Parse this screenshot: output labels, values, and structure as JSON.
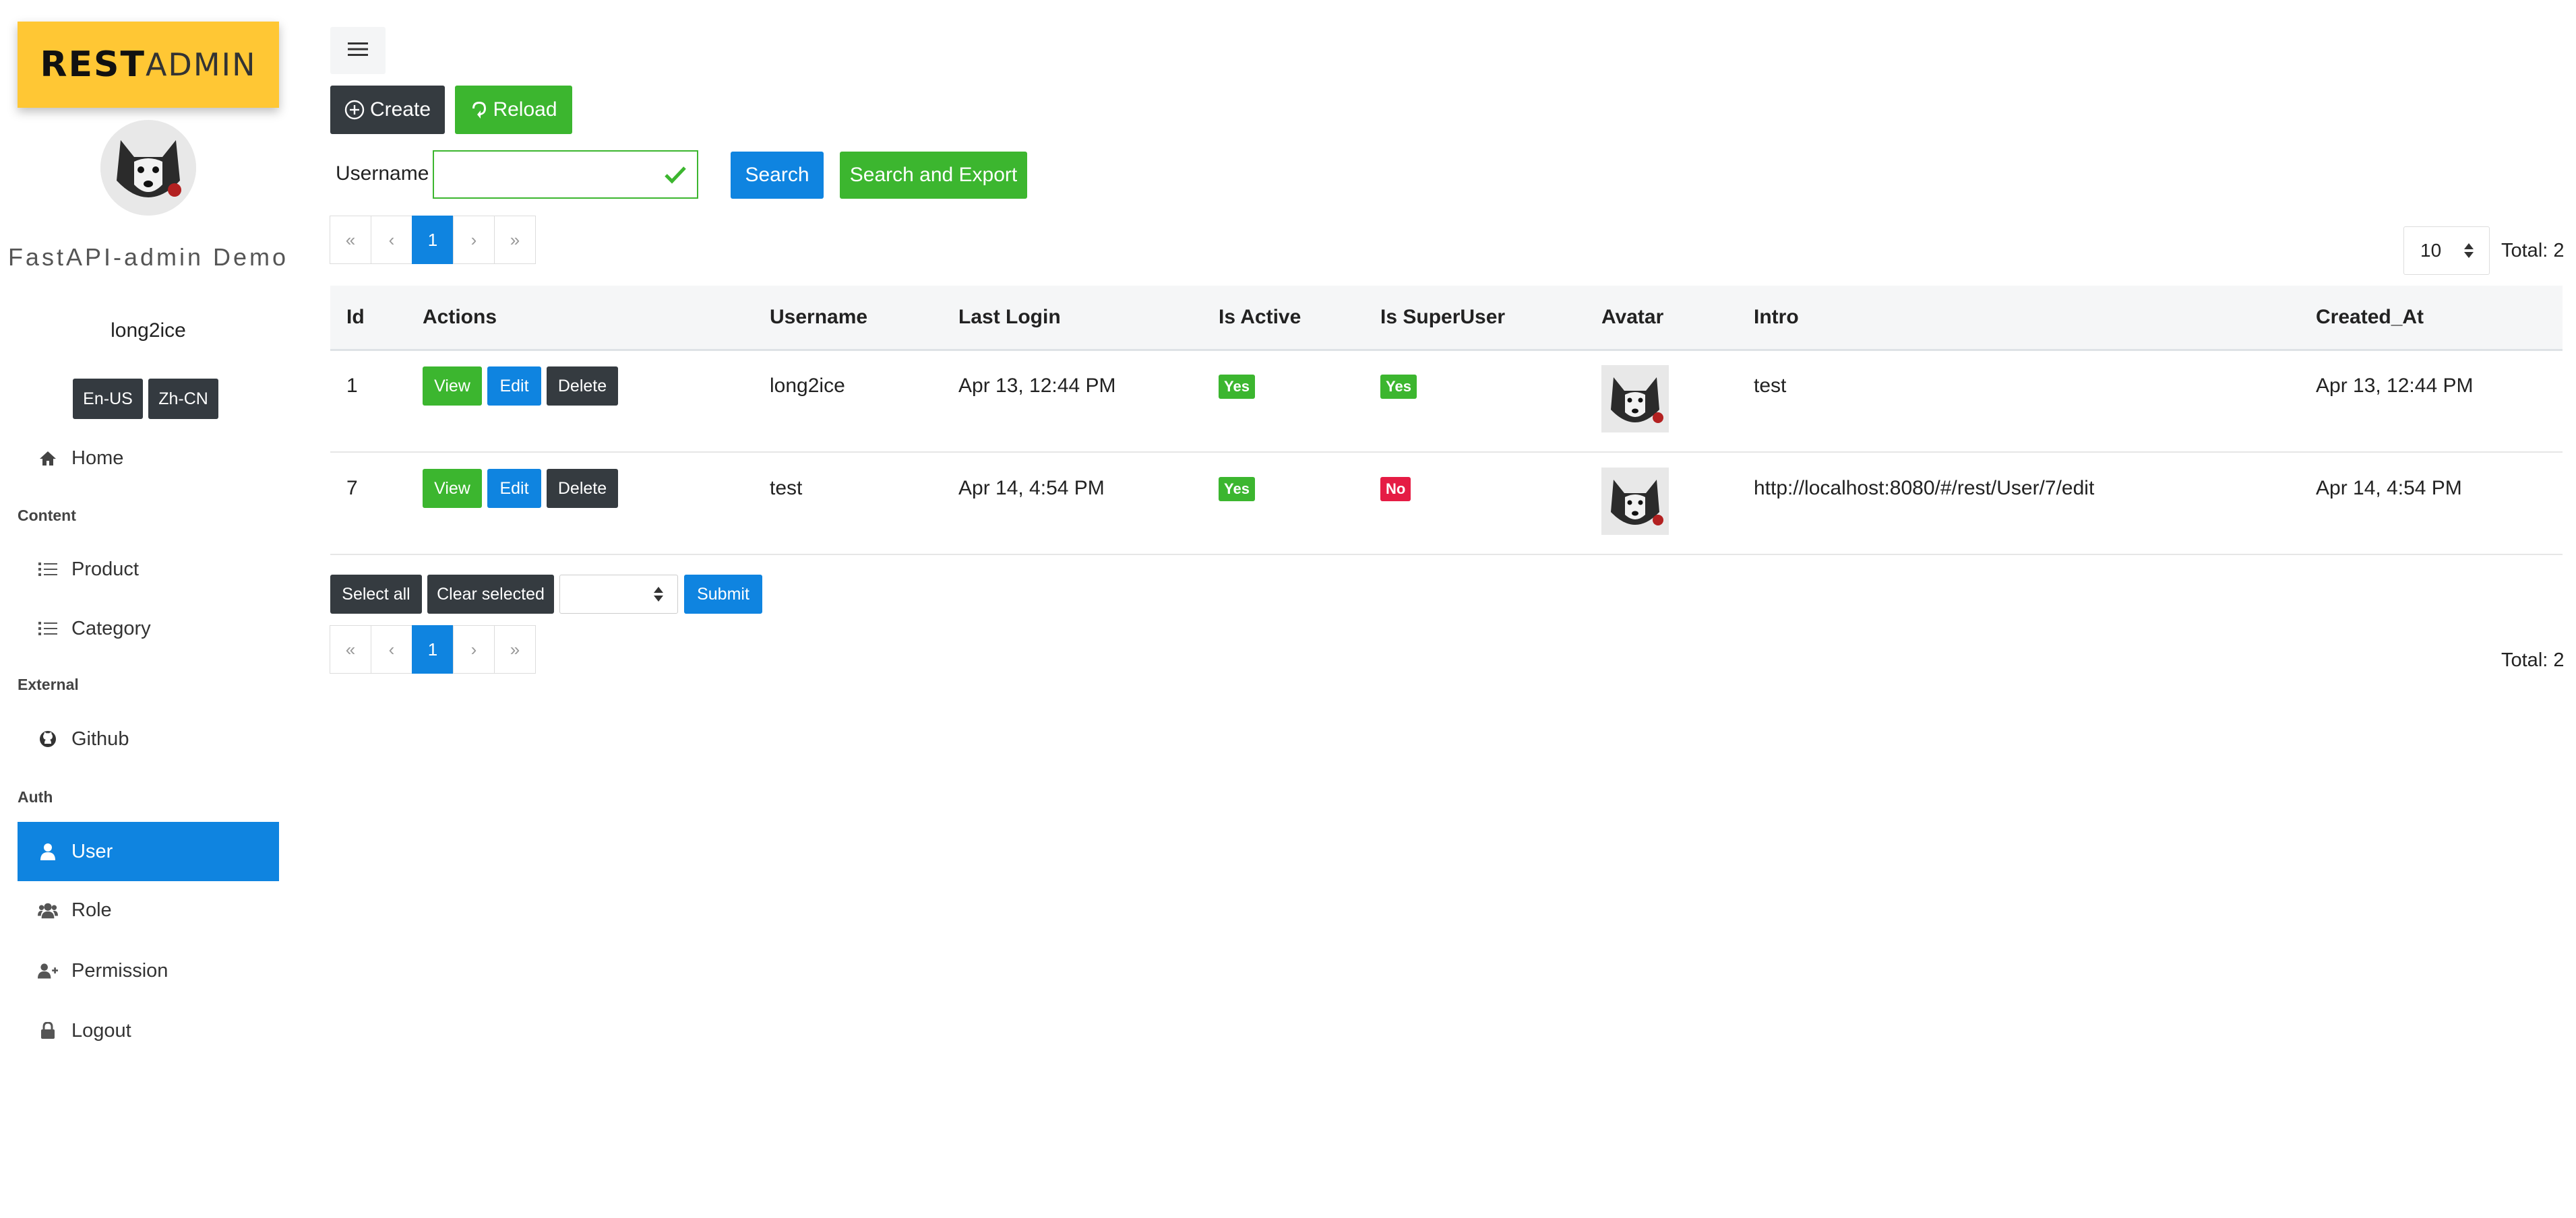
{
  "brand": {
    "logo_rest": "REST",
    "logo_admin": "ADMIN"
  },
  "sidebar": {
    "site_name": "FastAPI-admin Demo",
    "user_name": "long2ice",
    "lang_buttons": [
      "En-US",
      "Zh-CN"
    ],
    "home": "Home",
    "sections": {
      "content": "Content",
      "external": "External",
      "auth": "Auth"
    },
    "items": {
      "product": "Product",
      "category": "Category",
      "github": "Github",
      "user": "User",
      "role": "Role",
      "permission": "Permission",
      "logout": "Logout"
    },
    "active_item": "User"
  },
  "toolbar": {
    "create_label": "Create",
    "reload_label": "Reload"
  },
  "filter": {
    "username_label": "Username",
    "username_value": "",
    "search_label": "Search",
    "search_export_label": "Search and Export"
  },
  "pagination": {
    "first": "«",
    "prev": "‹",
    "current": "1",
    "next": "›",
    "last": "»",
    "per_page": "10",
    "total_label": "Total: 2"
  },
  "table": {
    "columns": [
      "Id",
      "Actions",
      "Username",
      "Last Login",
      "Is Active",
      "Is SuperUser",
      "Avatar",
      "Intro",
      "Created_At"
    ],
    "action_labels": {
      "view": "View",
      "edit": "Edit",
      "delete": "Delete"
    },
    "rows": [
      {
        "id": "1",
        "username": "long2ice",
        "last_login": "Apr 13, 12:44 PM",
        "is_active": "Yes",
        "is_superuser": "Yes",
        "intro": "test",
        "created_at": "Apr 13, 12:44 PM"
      },
      {
        "id": "7",
        "username": "test",
        "last_login": "Apr 14, 4:54 PM",
        "is_active": "Yes",
        "is_superuser": "No",
        "intro": "http://localhost:8080/#/rest/User/7/edit",
        "created_at": "Apr 14, 4:54 PM"
      }
    ]
  },
  "bulk": {
    "select_all": "Select all",
    "clear_selected": "Clear selected",
    "action_value": "",
    "submit": "Submit"
  },
  "colors": {
    "primary": "#0f84e0",
    "success": "#3cb62f",
    "danger": "#e51c44",
    "dark": "#353b40",
    "logo_bg": "#ffc734"
  },
  "icons": {
    "menu": "hamburger-icon",
    "create": "plus-circle-icon",
    "reload": "reload-icon",
    "home": "home-icon",
    "list": "list-icon",
    "github": "github-icon",
    "user": "user-icon",
    "role": "users-icon",
    "permission": "user-plus-icon",
    "logout": "lock-icon"
  }
}
